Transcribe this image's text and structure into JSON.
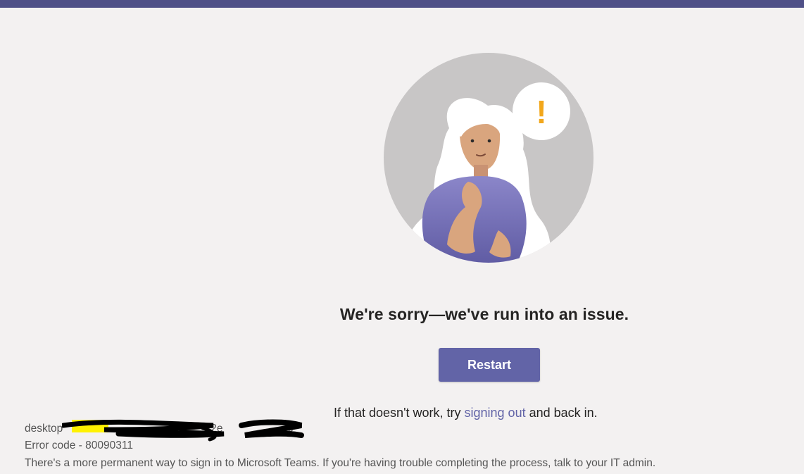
{
  "window": {
    "top_bar_color": "#4f5087"
  },
  "illustration": {
    "icon": "confused-person-with-alert-thought-bubble-illustration",
    "bubble_symbol": "!"
  },
  "error_screen": {
    "headline": "We're sorry—we've run into an issue.",
    "restart_label": "Restart",
    "help_prefix": "If that doesn't work, try ",
    "help_link": "signing out",
    "help_suffix": " and back in."
  },
  "diagnostics": {
    "session_prefix": "desktop",
    "session_visible_mid": "2e",
    "session_visible_end": "c",
    "error_code": "Error code - 80090311",
    "note": "There's a more permanent way to sign in to Microsoft Teams. If you're having trouble completing the process, talk to your IT admin."
  },
  "colors": {
    "accent": "#6264a7",
    "background": "#f3f1f1",
    "text": "#252423",
    "muted_text": "#555555",
    "redaction_highlight": "#fff200"
  }
}
